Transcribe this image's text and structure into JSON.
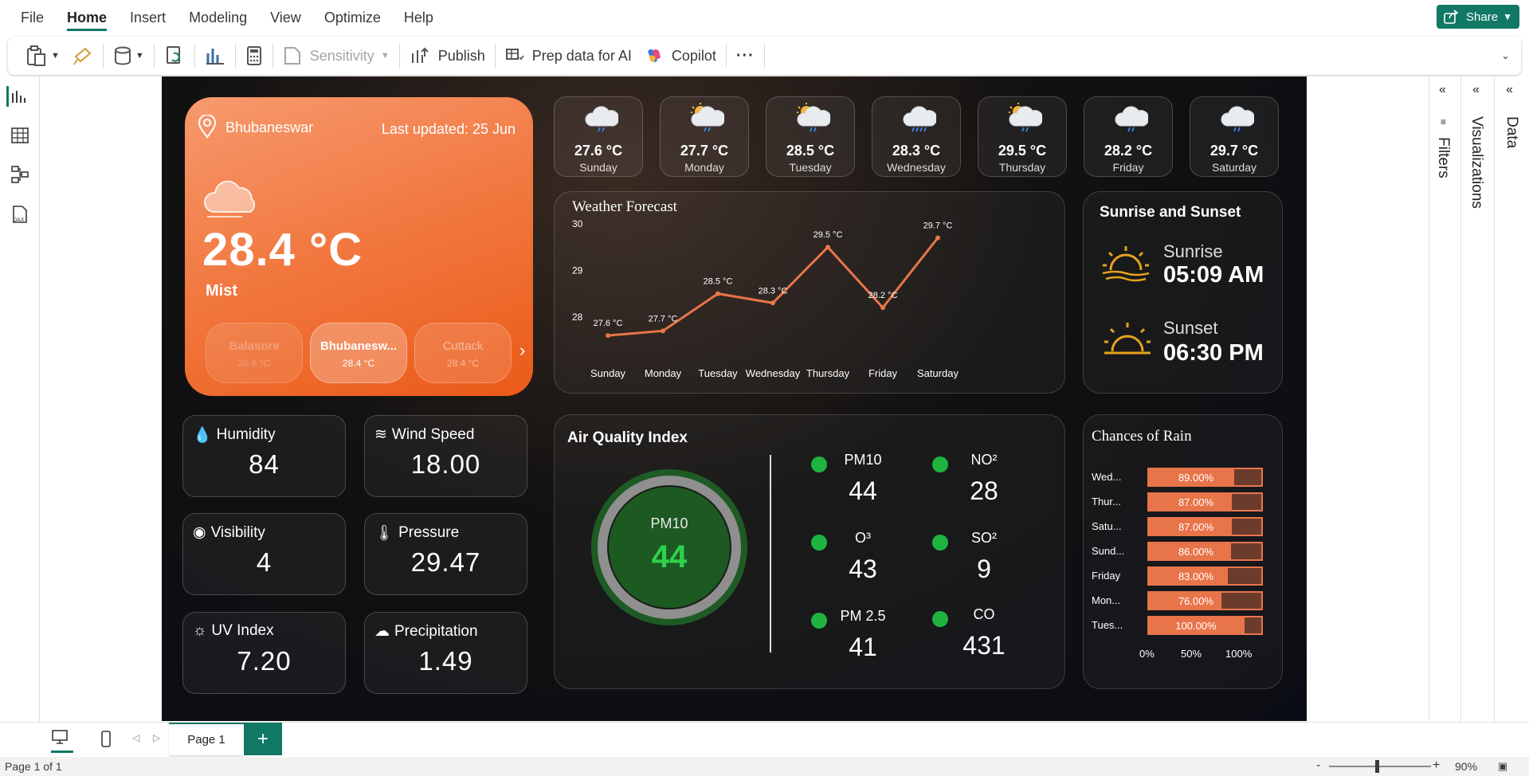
{
  "menu": {
    "items": [
      "File",
      "Home",
      "Insert",
      "Modeling",
      "View",
      "Optimize",
      "Help"
    ],
    "active": "Home"
  },
  "share_label": "Share",
  "ribbon": {
    "sensitivity": "Sensitivity",
    "publish": "Publish",
    "prep_data": "Prep data for AI",
    "copilot": "Copilot",
    "more": "···"
  },
  "current": {
    "city": "Bhubaneswar",
    "last_updated": "Last updated: 25 Jun",
    "temp": "28.4 °C",
    "condition": "Mist"
  },
  "cities": [
    {
      "name": "Balasore",
      "temp": "30.6 °C"
    },
    {
      "name": "Bhubanesw...",
      "temp": "28.4 °C"
    },
    {
      "name": "Cuttack",
      "temp": "28.4 °C"
    }
  ],
  "forecast_days": [
    {
      "temp": "27.6 °C",
      "day": "Sunday",
      "icon": "rain-cloud-icon"
    },
    {
      "temp": "27.7 °C",
      "day": "Monday",
      "icon": "sun-rain-cloud-icon"
    },
    {
      "temp": "28.5 °C",
      "day": "Tuesday",
      "icon": "sun-rain-cloud-icon"
    },
    {
      "temp": "28.3 °C",
      "day": "Wednesday",
      "icon": "heavy-rain-cloud-icon"
    },
    {
      "temp": "29.5 °C",
      "day": "Thursday",
      "icon": "sun-rain-cloud-icon"
    },
    {
      "temp": "28.2 °C",
      "day": "Friday",
      "icon": "rain-cloud-icon"
    },
    {
      "temp": "29.7 °C",
      "day": "Saturday",
      "icon": "rain-cloud-icon"
    }
  ],
  "metrics": {
    "humidity": {
      "label": "Humidity",
      "value": "84"
    },
    "wind": {
      "label": "Wind Speed",
      "value": "18.00"
    },
    "visibility": {
      "label": "Visibility",
      "value": "4"
    },
    "pressure": {
      "label": "Pressure",
      "value": "29.47"
    },
    "uv": {
      "label": "UV Index",
      "value": "7.20"
    },
    "precip": {
      "label": "Precipitation",
      "value": "1.49"
    }
  },
  "sun": {
    "title": "Sunrise and Sunset",
    "sunrise_label": "Sunrise",
    "sunrise": "05:09 AM",
    "sunset_label": "Sunset",
    "sunset": "06:30 PM"
  },
  "aqi": {
    "title": "Air Quality Index",
    "gauge_label": "PM10",
    "gauge_value": "44",
    "items": [
      {
        "name": "PM10",
        "value": "44"
      },
      {
        "name": "NO²",
        "value": "28"
      },
      {
        "name": "O³",
        "value": "43"
      },
      {
        "name": "SO²",
        "value": "9"
      },
      {
        "name": "PM 2.5",
        "value": "41"
      },
      {
        "name": "CO",
        "value": "431"
      }
    ]
  },
  "chart_data": [
    {
      "type": "line",
      "title": "Weather Forecast",
      "categories": [
        "Sunday",
        "Monday",
        "Tuesday",
        "Wednesday",
        "Thursday",
        "Friday",
        "Saturday"
      ],
      "values": [
        27.6,
        27.7,
        28.5,
        28.3,
        29.5,
        28.2,
        29.7
      ],
      "data_labels": [
        "27.6 °C",
        "27.7 °C",
        "28.5 °C",
        "28.3 °C",
        "29.5 °C",
        "28.2 °C",
        "29.7 °C"
      ],
      "yticks": [
        "28",
        "29",
        "30"
      ],
      "ylim": [
        27.5,
        30
      ],
      "color": "#e8754a"
    },
    {
      "type": "bar",
      "title": "Chances of Rain",
      "categories": [
        "Wed...",
        "Thur...",
        "Satu...",
        "Sund...",
        "Friday",
        "Mon...",
        "Tues..."
      ],
      "values": [
        89,
        87,
        87,
        86,
        83,
        76,
        100
      ],
      "data_labels": [
        "89.00%",
        "87.00%",
        "87.00%",
        "86.00%",
        "83.00%",
        "76.00%",
        "100.00%"
      ],
      "xticks": [
        "0%",
        "50%",
        "100%"
      ],
      "color": "#e8754a"
    }
  ],
  "pages": {
    "current": "Page 1"
  },
  "status": {
    "page_indicator": "Page 1 of 1",
    "zoom": "90%",
    "zoom_level": 0.45
  },
  "panes": {
    "filters": "Filters",
    "visualizations": "Visualizations",
    "data": "Data"
  }
}
